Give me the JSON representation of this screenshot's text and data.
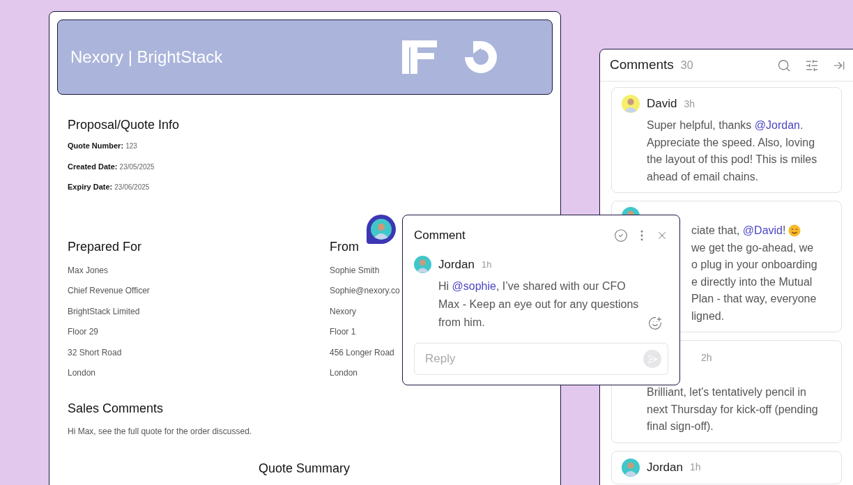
{
  "document": {
    "banner_title": "Nexory | BrightStack",
    "info": {
      "heading": "Proposal/Quote Info",
      "fields": [
        {
          "label": "Quote Number:",
          "value": "123"
        },
        {
          "label": "Created Date:",
          "value": "23/05/2025"
        },
        {
          "label": "Expiry Date:",
          "value": "23/06/2025"
        }
      ]
    },
    "prepared_for": {
      "heading": "Prepared For",
      "lines": [
        "Max Jones",
        "Chief Revenue Officer",
        "BrightStack Limited",
        "Floor 29",
        "32 Short Road",
        "London"
      ]
    },
    "from": {
      "heading": "From",
      "lines": [
        "Sophie Smith",
        "Sophie@nexory.co",
        "Nexory",
        "Floor 1",
        "456 Longer Road",
        "London"
      ]
    },
    "sales_comments": {
      "heading": "Sales Comments",
      "text": "Hi Max, see the full quote for the order discussed."
    },
    "summary_heading": "Quote Summary"
  },
  "comment_popup": {
    "title": "Comment",
    "author": "Jordan",
    "time": "1h",
    "before": "Hi ",
    "mention": "@sophie",
    "after": ",  I’ve shared with our CFO Max - Keep an eye out for any questions from him.",
    "reply_placeholder": "Reply"
  },
  "sidebar": {
    "title": "Comments",
    "count": "30",
    "comments": [
      {
        "kind": "full",
        "author": "David",
        "time": "3h",
        "before": "Super helpful, thanks ",
        "mention": "@Jordan",
        "after": ". Appreciate the speed. Also, loving the layout of this pod! This is miles ahead of email chains."
      },
      {
        "kind": "covered",
        "lines": [
          {
            "kind": "mention_emoji",
            "before": "ciate that, ",
            "mention": "@David",
            "after": "!"
          },
          {
            "kind": "plain",
            "before": "we get the go-ahead, we"
          },
          {
            "kind": "plain",
            "before": "o plug in your onboarding"
          },
          {
            "kind": "plain",
            "before": "e directly into the Mutual"
          },
          {
            "kind": "plain",
            "before": "Plan - that way, everyone"
          },
          {
            "kind": "plain",
            "before": "ligned."
          }
        ]
      },
      {
        "kind": "covered_header",
        "time": "2h",
        "before": "Brilliant, let's tentatively pencil in next Thursday for kick-off (pending final sign-off)."
      },
      {
        "kind": "full",
        "author": "Jordan",
        "time": "1h"
      }
    ]
  }
}
